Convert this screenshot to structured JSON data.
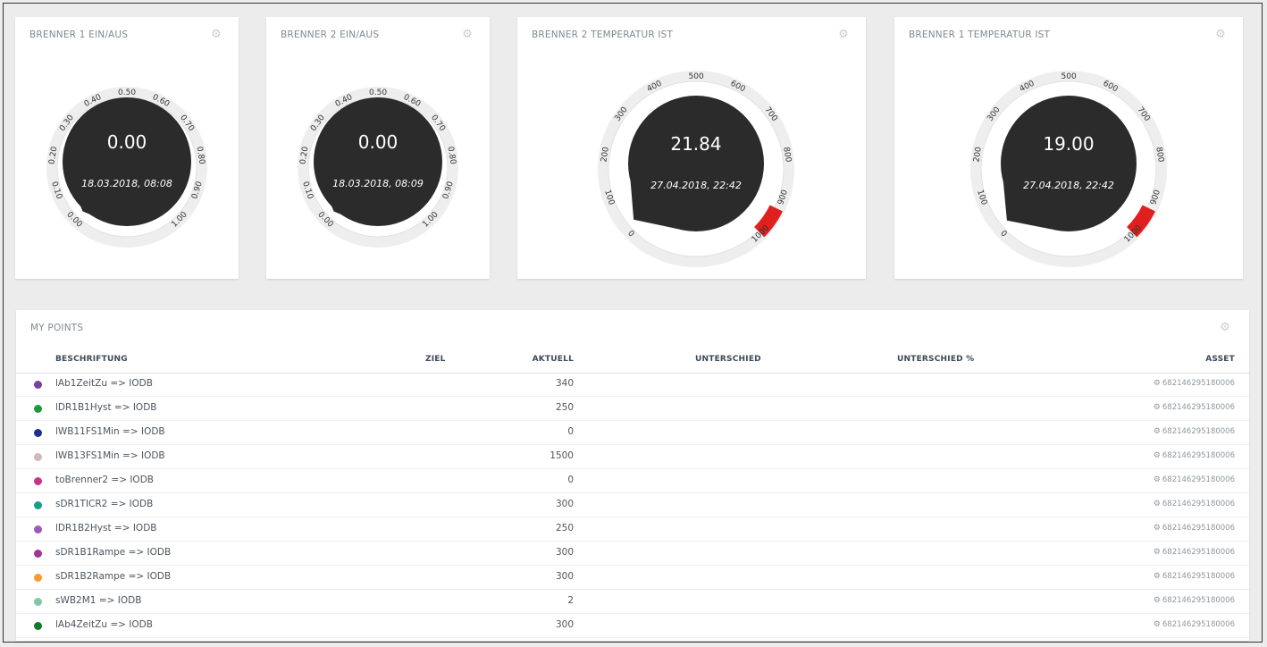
{
  "widgets": [
    {
      "title": "BRENNER 1 EIN/AUS",
      "value": "0.00",
      "date": "18.03.2018, 08:08",
      "ticks": [
        "0.00",
        "0.10",
        "0.20",
        "0.30",
        "0.40",
        "0.50",
        "0.60",
        "0.70",
        "0.80",
        "0.90",
        "1.00"
      ],
      "reading_fraction": 0.0,
      "has_alarm": false
    },
    {
      "title": "BRENNER 2 EIN/AUS",
      "value": "0.00",
      "date": "18.03.2018, 08:09",
      "ticks": [
        "0.00",
        "0.10",
        "0.20",
        "0.30",
        "0.40",
        "0.50",
        "0.60",
        "0.70",
        "0.80",
        "0.90",
        "1.00"
      ],
      "reading_fraction": 0.0,
      "has_alarm": false
    },
    {
      "title": "BRENNER 2 TEMPERATUR IST",
      "value": "21.84",
      "date": "27.04.2018, 22:42",
      "ticks": [
        "0",
        "100",
        "200",
        "300",
        "400",
        "500",
        "600",
        "700",
        "800",
        "900",
        "1000"
      ],
      "reading_fraction": 0.02184,
      "has_alarm": true
    },
    {
      "title": "BRENNER 1 TEMPERATUR IST",
      "value": "19.00",
      "date": "27.04.2018, 22:42",
      "ticks": [
        "0",
        "100",
        "200",
        "300",
        "400",
        "500",
        "600",
        "700",
        "800",
        "900",
        "1000"
      ],
      "reading_fraction": 0.019,
      "has_alarm": true
    }
  ],
  "colors": {
    "gauge_face": "#2b2b2b",
    "alarm": "#e0201f",
    "ring": "#eeeeee"
  },
  "gear_icon": "gear-icon",
  "points": {
    "title": "MY POINTS",
    "headers": {
      "label": "BESCHRIFTUNG",
      "ziel": "ZIEL",
      "aktuell": "AKTUELL",
      "unterschied": "UNTERSCHIED",
      "unterschied_pct": "UNTERSCHIED %",
      "asset": "ASSET"
    },
    "rows": [
      {
        "label": "lAb1ZeitZu => IODB",
        "aktuell": "340",
        "asset": "682146295180006",
        "color": "#7b3f9e"
      },
      {
        "label": "lDR1B1Hyst => IODB",
        "aktuell": "250",
        "asset": "682146295180006",
        "color": "#1e9a3a"
      },
      {
        "label": "lWB11FS1Min => IODB",
        "aktuell": "0",
        "asset": "682146295180006",
        "color": "#1f2f8f"
      },
      {
        "label": "lWB13FS1Min => IODB",
        "aktuell": "1500",
        "asset": "682146295180006",
        "color": "#d4b8b8"
      },
      {
        "label": "toBrenner2 => IODB",
        "aktuell": "0",
        "asset": "682146295180006",
        "color": "#c7358c"
      },
      {
        "label": "sDR1TICR2 => IODB",
        "aktuell": "300",
        "asset": "682146295180006",
        "color": "#15a085"
      },
      {
        "label": "lDR1B2Hyst => IODB",
        "aktuell": "250",
        "asset": "682146295180006",
        "color": "#9b5bb5"
      },
      {
        "label": "sDR1B1Rampe => IODB",
        "aktuell": "300",
        "asset": "682146295180006",
        "color": "#a0368f"
      },
      {
        "label": "sDR1B2Rampe => IODB",
        "aktuell": "300",
        "asset": "682146295180006",
        "color": "#f39c2b"
      },
      {
        "label": "sWB2M1 => IODB",
        "aktuell": "2",
        "asset": "682146295180006",
        "color": "#7fc9a5"
      },
      {
        "label": "lAb4ZeitZu => IODB",
        "aktuell": "300",
        "asset": "682146295180006",
        "color": "#117a2a"
      }
    ]
  }
}
